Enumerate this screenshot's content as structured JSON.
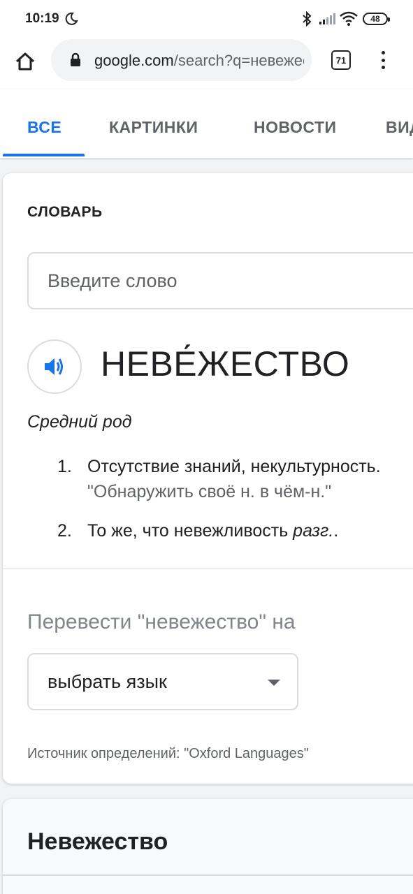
{
  "status_bar": {
    "time": "10:19",
    "battery": "48"
  },
  "browser": {
    "url_domain": "google.com",
    "url_path": "/search?q=невежество",
    "tab_count": "71"
  },
  "search_tabs": [
    {
      "label": "ВСЕ",
      "active": true
    },
    {
      "label": "КАРТИНКИ",
      "active": false
    },
    {
      "label": "НОВОСТИ",
      "active": false
    },
    {
      "label": "ВИДЕО",
      "active": false
    }
  ],
  "dictionary": {
    "title": "СЛОВАРЬ",
    "input_placeholder": "Введите слово",
    "headword": "НЕВЕ́ЖЕСТВО",
    "part_of_speech": "Средний род",
    "definitions": [
      {
        "num": "1.",
        "text": "Отсутствие знаний, некультурность.",
        "example": "\"Обнаружить своё н. в чём-н.\""
      },
      {
        "num": "2.",
        "text": "То же, что невежливость ",
        "label": "разг.",
        "tail": "."
      }
    ],
    "translate_label": "Перевести \"невежество\" на",
    "language_select": "выбрать язык",
    "source": "Источник определений: \"Oxford Languages\""
  },
  "next_card": {
    "title": "Невежество"
  },
  "colors": {
    "accent": "#1a73e8",
    "text": "#202124",
    "muted": "#5f6368"
  }
}
